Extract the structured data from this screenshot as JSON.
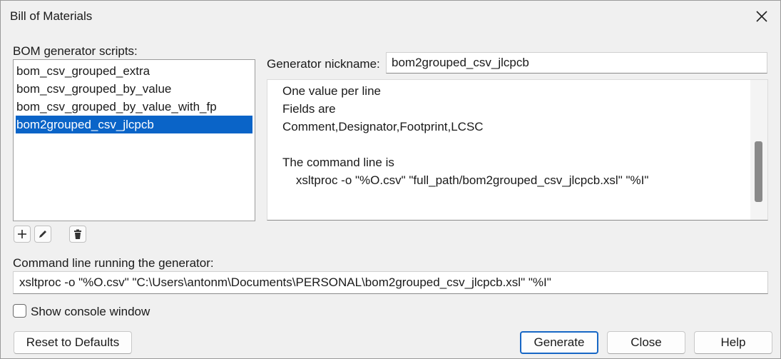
{
  "window": {
    "title": "Bill of Materials"
  },
  "scripts": {
    "label": "BOM generator scripts:",
    "items": [
      {
        "label": "bom_csv_grouped_extra",
        "selected": false
      },
      {
        "label": "bom_csv_grouped_by_value",
        "selected": false
      },
      {
        "label": "bom_csv_grouped_by_value_with_fp",
        "selected": false
      },
      {
        "label": "bom2grouped_csv_jlcpcb",
        "selected": true
      }
    ],
    "toolbar": [
      "plus-icon",
      "pencil-icon",
      "trash-icon"
    ]
  },
  "nickname": {
    "label": "Generator nickname:",
    "value": "bom2grouped_csv_jlcpcb"
  },
  "help_text": {
    "lines": [
      "One value per line",
      "Fields are",
      "Comment,Designator,Footprint,LCSC",
      "",
      "The command line is",
      "    xsltproc -o \"%O.csv\" \"full_path/bom2grouped_csv_jlcpcb.xsl\" \"%I\""
    ]
  },
  "command": {
    "label": "Command line running the generator:",
    "value": "xsltproc -o \"%O.csv\" \"C:\\Users\\antonm\\Documents\\PERSONAL\\bom2grouped_csv_jlcpcb.xsl\" \"%I\""
  },
  "console": {
    "label": "Show console window",
    "checked": false
  },
  "buttons": {
    "reset": "Reset to Defaults",
    "generate": "Generate",
    "close": "Close",
    "help": "Help"
  },
  "colors": {
    "selection": "#0a64c8",
    "primary_border": "#1767c5"
  }
}
